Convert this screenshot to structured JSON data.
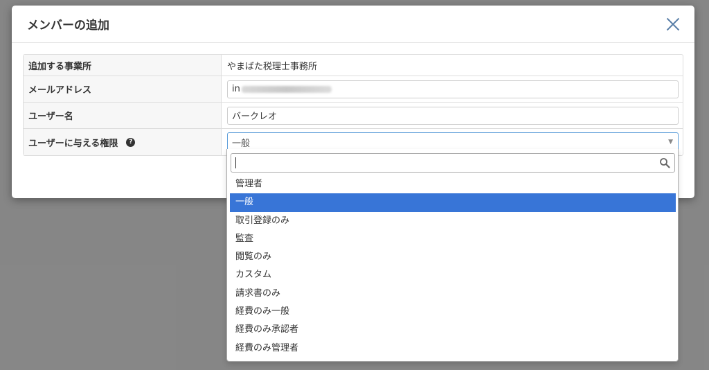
{
  "modal": {
    "title": "メンバーの追加",
    "rows": [
      {
        "label": "追加する事業所",
        "value": "やまばた税理士事務所"
      },
      {
        "label": "メールアドレス",
        "value": "in"
      },
      {
        "label": "ユーザー名",
        "value": "バークレオ"
      },
      {
        "label": "ユーザーに与える権限",
        "value": "一般"
      }
    ]
  },
  "dropdown": {
    "options": [
      "管理者",
      "一般",
      "取引登録のみ",
      "監査",
      "閲覧のみ",
      "カスタム",
      "請求書のみ",
      "経費のみ一般",
      "経費のみ承認者",
      "経費のみ管理者"
    ],
    "highlighted_index": 1
  },
  "colors": {
    "highlight": "#3875d7",
    "close": "#5a7fa8",
    "focus_border": "#5b9dd9"
  },
  "icons": {
    "close": "close-icon",
    "help": "question-circle-icon",
    "search": "search-icon",
    "caret": "caret-down-icon"
  }
}
